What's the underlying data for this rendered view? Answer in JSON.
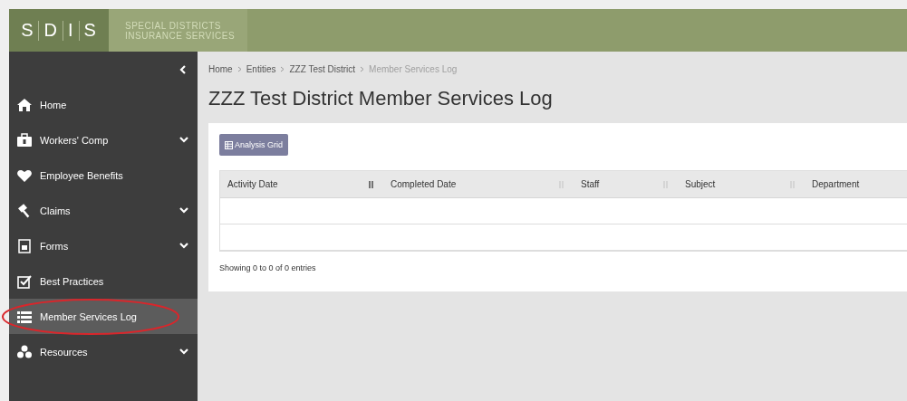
{
  "header": {
    "logo": [
      "S",
      "D",
      "I",
      "S"
    ],
    "org_name": [
      "SPECIAL DISTRICTS",
      "INSURANCE SERVICES"
    ]
  },
  "sidebar": {
    "items": [
      {
        "label": "Home",
        "expandable": false,
        "selected": false
      },
      {
        "label": "Workers' Comp",
        "expandable": true,
        "selected": false
      },
      {
        "label": "Employee Benefits",
        "expandable": false,
        "selected": false
      },
      {
        "label": "Claims",
        "expandable": true,
        "selected": false
      },
      {
        "label": "Forms",
        "expandable": true,
        "selected": false
      },
      {
        "label": "Best Practices",
        "expandable": false,
        "selected": false
      },
      {
        "label": "Member Services Log",
        "expandable": false,
        "selected": true,
        "circled": true
      },
      {
        "label": "Resources",
        "expandable": true,
        "selected": false
      }
    ]
  },
  "breadcrumb": [
    {
      "label": "Home",
      "current": false
    },
    {
      "label": "Entities",
      "current": false
    },
    {
      "label": "ZZZ Test District",
      "current": false
    },
    {
      "label": "Member Services Log",
      "current": true
    }
  ],
  "page_title": "ZZZ Test District Member Services Log",
  "toolbar": {
    "button": "Analysis Grid"
  },
  "table": {
    "columns": [
      {
        "label": "Activity Date",
        "sorted": true
      },
      {
        "label": "Completed Date",
        "sorted": false
      },
      {
        "label": "Staff",
        "sorted": false
      },
      {
        "label": "Subject",
        "sorted": false
      },
      {
        "label": "Department"
      }
    ],
    "info": "Showing 0 to 0 of 0 entries"
  }
}
